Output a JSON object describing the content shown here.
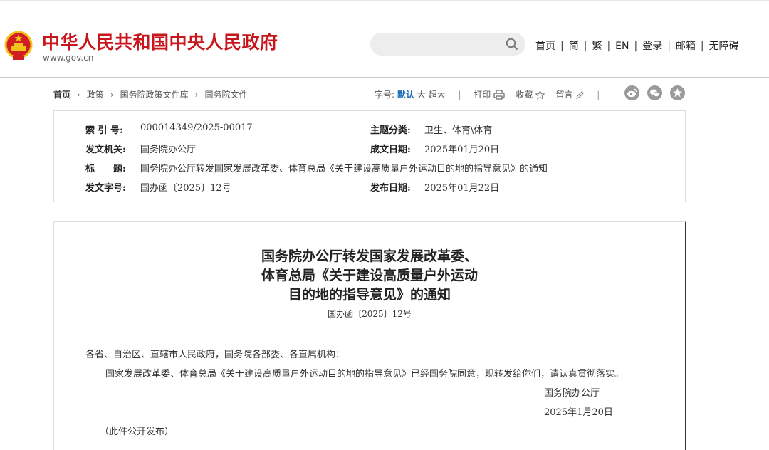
{
  "header": {
    "site_title": "中华人民共和国中央人民政府",
    "site_domain": "www.gov.cn",
    "search_placeholder": "",
    "links": [
      "首页",
      "简",
      "繁",
      "EN",
      "登录",
      "邮箱",
      "无障碍"
    ]
  },
  "breadcrumb": [
    "首页",
    "政策",
    "国务院政策文件库",
    "国务院文件"
  ],
  "tools": {
    "font_label": "字号:",
    "font_default": "默认",
    "font_large": "大",
    "font_xlarge": "超大",
    "print": "打印",
    "favorite": "收藏",
    "comment": "留言"
  },
  "social_icons": [
    "weibo-icon",
    "wechat-icon",
    "star-icon"
  ],
  "meta": {
    "index_label": "索 引 号:",
    "index_value": "000014349/2025-00017",
    "category_label": "主题分类:",
    "category_value": "卫生、体育\\体育",
    "issuer_label": "发文机关:",
    "issuer_value": "国务院办公厅",
    "date_written_label": "成文日期:",
    "date_written_value": "2025年01月20日",
    "title_label": "标　　题:",
    "title_value": "国务院办公厅转发国家发展改革委、体育总局《关于建设高质量户外运动目的地的指导意见》的通知",
    "docno_label": "发文字号:",
    "docno_value": "国办函〔2025〕12号",
    "date_published_label": "发布日期:",
    "date_published_value": "2025年01月22日"
  },
  "document": {
    "title_lines": [
      "国务院办公厅转发国家发展改革委、",
      "体育总局《关于建设高质量户外运动",
      "目的地的指导意见》的通知"
    ],
    "doc_number": "国办函〔2025〕12号",
    "salutation": "各省、自治区、直辖市人民政府，国务院各部委、各直属机构：",
    "body": "国家发展改革委、体育总局《关于建设高质量户外运动目的地的指导意见》已经国务院同意，现转发给你们，请认真贯彻落实。",
    "signer": "国务院办公厅",
    "sign_date": "2025年1月20日",
    "note": "（此件公开发布）"
  },
  "colors": {
    "brand_red": "#c8161d",
    "emblem_gold": "#f2c21a",
    "link_blue": "#1b6fb7"
  }
}
